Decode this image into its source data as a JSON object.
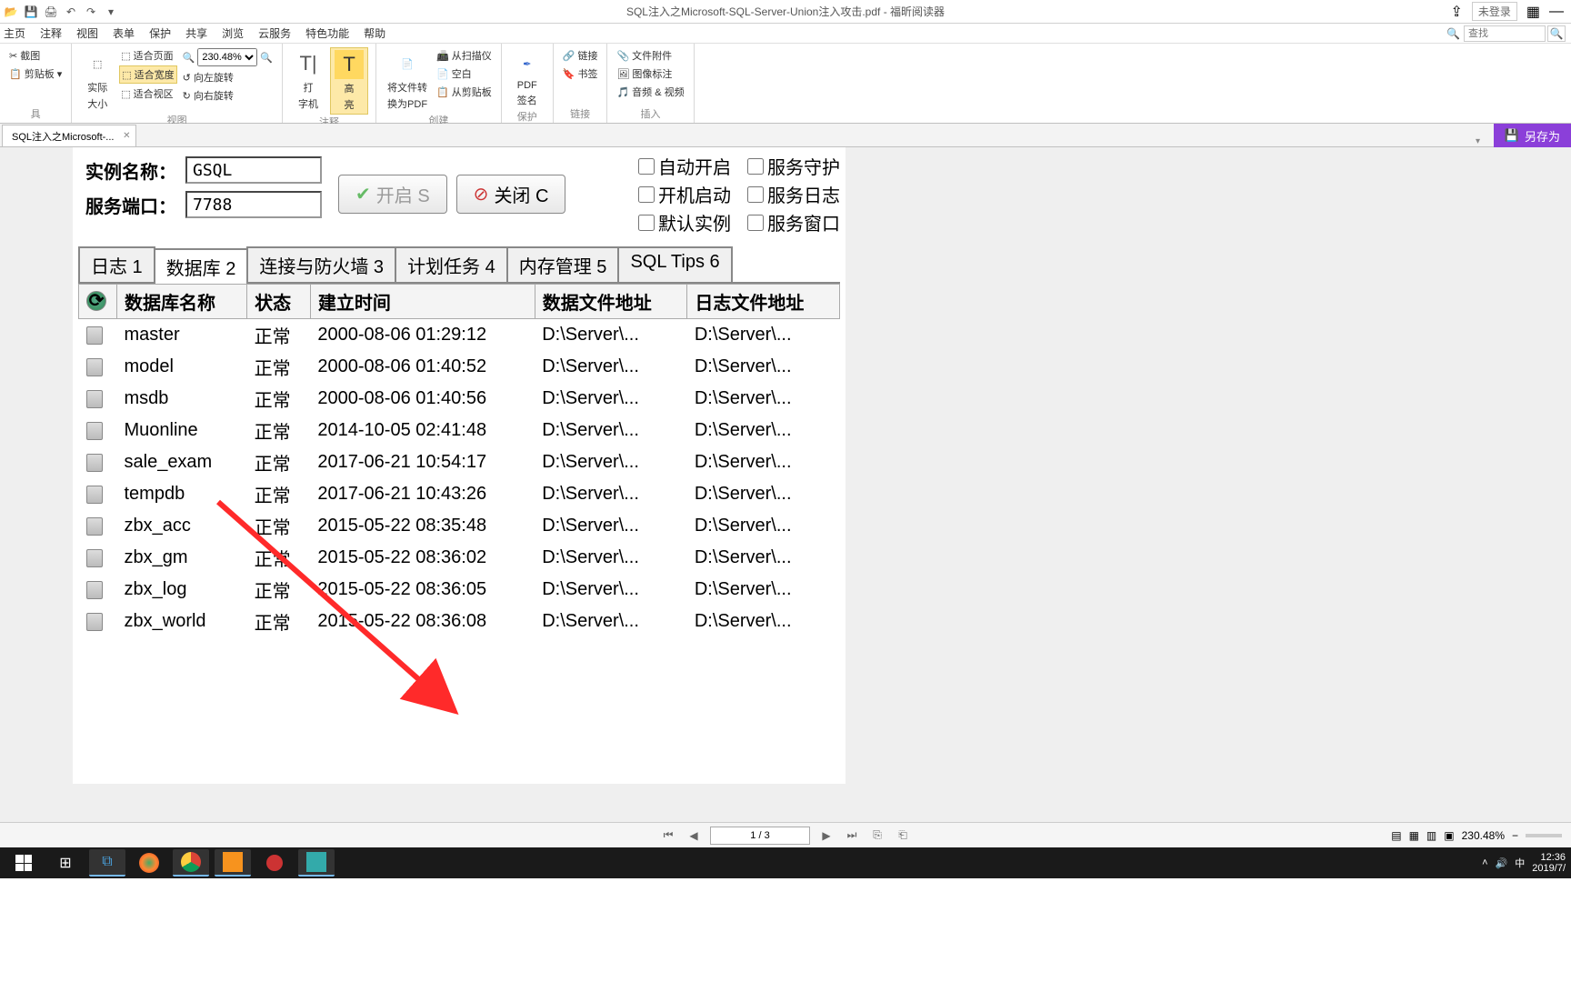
{
  "window": {
    "title": "SQL注入之Microsoft-SQL-Server-Union注入攻击.pdf - 福昕阅读器",
    "login_status": "未登录"
  },
  "menu": {
    "items": [
      "主页",
      "注释",
      "视图",
      "表单",
      "保护",
      "共享",
      "浏览",
      "云服务",
      "特色功能",
      "帮助"
    ],
    "search_placeholder": "查找"
  },
  "ribbon": {
    "tools_label": "具",
    "screenshot": "截图",
    "clipboard": "剪贴板",
    "actual": "实际",
    "size": "大小",
    "fit_page": "适合页面",
    "fit_width": "适合宽度",
    "fit_view": "适合视区",
    "rotate_left": "向左旋转",
    "rotate_right": "向右旋转",
    "zoom_value": "230.48%",
    "view_label": "视图",
    "typewriter1": "打",
    "typewriter2": "字机",
    "highlight1": "高",
    "highlight2": "亮",
    "annotate_label": "注释",
    "convert1": "将文件转",
    "convert2": "换为PDF",
    "scan": "从扫描仪",
    "blank": "空白",
    "clipboard2": "从剪贴板",
    "create_label": "创建",
    "pdf1": "PDF",
    "pdf2": "签名",
    "protect_label": "保护",
    "link": "链接",
    "bookmark": "书签",
    "link_label": "链接",
    "attachment": "文件附件",
    "image_annot": "图像标注",
    "av": "音频 & 视频",
    "insert_label": "插入"
  },
  "doc_tab": {
    "name": "SQL注入之Microsoft-...",
    "saveas": "另存为"
  },
  "sqldlg": {
    "instance_label": "实例名称：",
    "instance_value": "GSQL",
    "port_label": "服务端口：",
    "port_value": "7788",
    "btn_start": "开启 S",
    "btn_stop": "关闭 C",
    "chk_autostart": "自动开启",
    "chk_bootstart": "开机启动",
    "chk_default": "默认实例",
    "chk_guard": "服务守护",
    "chk_log": "服务日志",
    "chk_window": "服务窗口",
    "tabs": [
      "日志 1",
      "数据库 2",
      "连接与防火墙 3",
      "计划任务 4",
      "内存管理 5",
      "SQL Tips 6"
    ],
    "columns": [
      "",
      "数据库名称",
      "状态",
      "建立时间",
      "数据文件地址",
      "日志文件地址"
    ],
    "rows": [
      {
        "name": "master",
        "status": "正常",
        "time": "2000-08-06 01:29:12",
        "data": "D:\\Server\\...",
        "log": "D:\\Server\\..."
      },
      {
        "name": "model",
        "status": "正常",
        "time": "2000-08-06 01:40:52",
        "data": "D:\\Server\\...",
        "log": "D:\\Server\\..."
      },
      {
        "name": "msdb",
        "status": "正常",
        "time": "2000-08-06 01:40:56",
        "data": "D:\\Server\\...",
        "log": "D:\\Server\\..."
      },
      {
        "name": "Muonline",
        "status": "正常",
        "time": "2014-10-05 02:41:48",
        "data": "D:\\Server\\...",
        "log": "D:\\Server\\..."
      },
      {
        "name": "sale_exam",
        "status": "正常",
        "time": "2017-06-21 10:54:17",
        "data": "D:\\Server\\...",
        "log": "D:\\Server\\..."
      },
      {
        "name": "tempdb",
        "status": "正常",
        "time": "2017-06-21 10:43:26",
        "data": "D:\\Server\\...",
        "log": "D:\\Server\\..."
      },
      {
        "name": "zbx_acc",
        "status": "正常",
        "time": "2015-05-22 08:35:48",
        "data": "D:\\Server\\...",
        "log": "D:\\Server\\..."
      },
      {
        "name": "zbx_gm",
        "status": "正常",
        "time": "2015-05-22 08:36:02",
        "data": "D:\\Server\\...",
        "log": "D:\\Server\\..."
      },
      {
        "name": "zbx_log",
        "status": "正常",
        "time": "2015-05-22 08:36:05",
        "data": "D:\\Server\\...",
        "log": "D:\\Server\\..."
      },
      {
        "name": "zbx_world",
        "status": "正常",
        "time": "2015-05-22 08:36:08",
        "data": "D:\\Server\\...",
        "log": "D:\\Server\\..."
      }
    ]
  },
  "statusbar": {
    "page": "1 / 3",
    "zoom": "230.48%"
  },
  "taskbar": {
    "time": "12:36",
    "date": "2019/7/",
    "ime": "中"
  }
}
